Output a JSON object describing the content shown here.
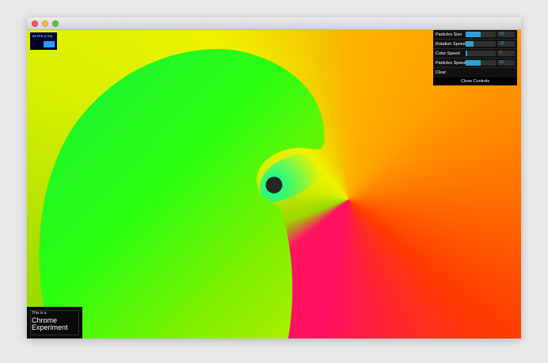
{
  "window": {
    "title_buttons": [
      "close",
      "minimize",
      "zoom"
    ]
  },
  "fps": {
    "label": "65 FPS (7-60)"
  },
  "controls": {
    "items": [
      {
        "label": "Particles Size",
        "value": "50",
        "level": 0.5
      },
      {
        "label": "Rotation Speed",
        "value": "25",
        "level": 0.25
      },
      {
        "label": "Color Speed",
        "value": "5",
        "level": 0.05
      },
      {
        "label": "Particles Speed",
        "value": "50",
        "level": 0.5
      }
    ],
    "clear_label": "Clear",
    "close_label": "Close Controls"
  },
  "badge": {
    "line1": "This is a",
    "line2": "Chrome",
    "line3": "Experiment"
  },
  "colors": {
    "accent": "#2fa1d6",
    "spiral": "#22ff22"
  }
}
